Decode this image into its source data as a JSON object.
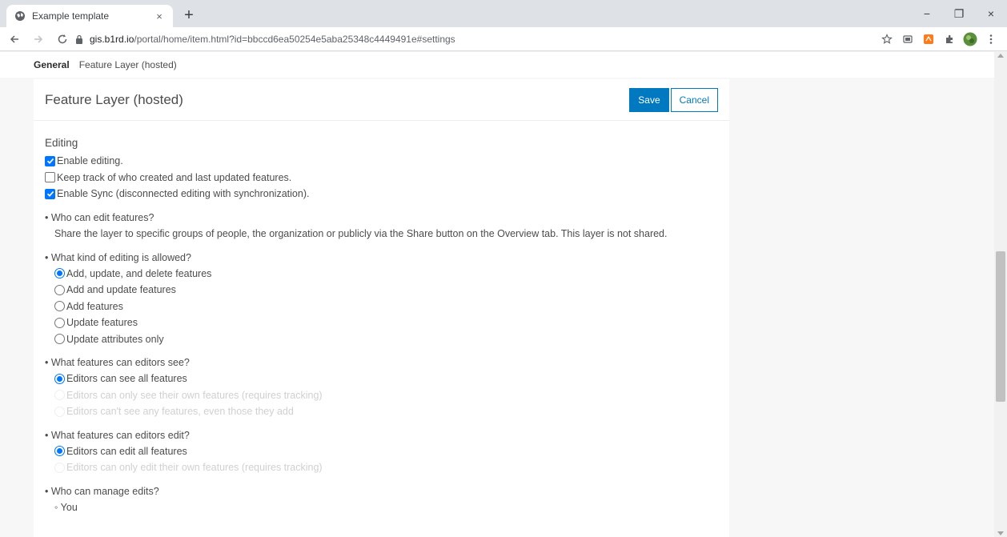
{
  "browser": {
    "tab_title": "Example template",
    "tab_close": "×",
    "new_tab": "+",
    "url_host": "gis.b1rd.io",
    "url_rest": "/portal/home/item.html?id=bbccd6ea50254e5aba25348c4449491e#settings",
    "win_minimize": "−",
    "win_maximize": "❐",
    "win_close": "×"
  },
  "subnav": {
    "active": "General",
    "link": "Feature Layer (hosted)"
  },
  "card": {
    "title": "Feature Layer (hosted)",
    "save_label": "Save",
    "cancel_label": "Cancel"
  },
  "editing": {
    "section_title": "Editing",
    "checks": [
      {
        "label": "Enable editing.",
        "checked": true
      },
      {
        "label": "Keep track of who created and last updated features.",
        "checked": false
      },
      {
        "label": "Enable Sync (disconnected editing with synchronization).",
        "checked": true
      }
    ]
  },
  "questions": {
    "who_edit": {
      "title": "• Who can edit features?",
      "desc": "Share the layer to specific groups of people, the organization or publicly via the Share button on the Overview tab. This layer is not shared."
    },
    "kind": {
      "title": "• What kind of editing is allowed?",
      "options": [
        {
          "label": "Add, update, and delete features",
          "selected": true
        },
        {
          "label": "Add and update features",
          "selected": false
        },
        {
          "label": "Add features",
          "selected": false
        },
        {
          "label": "Update features",
          "selected": false
        },
        {
          "label": "Update attributes only",
          "selected": false
        }
      ]
    },
    "see": {
      "title": "• What features can editors see?",
      "options": [
        {
          "label": "Editors can see all features",
          "selected": true,
          "disabled": false
        },
        {
          "label": "Editors can only see their own features (requires tracking)",
          "selected": false,
          "disabled": true
        },
        {
          "label": "Editors can't see any features, even those they add",
          "selected": false,
          "disabled": true
        }
      ]
    },
    "edit": {
      "title": "• What features can editors edit?",
      "options": [
        {
          "label": "Editors can edit all features",
          "selected": true,
          "disabled": false
        },
        {
          "label": "Editors can only edit their own features (requires tracking)",
          "selected": false,
          "disabled": true
        }
      ]
    },
    "manage": {
      "title": "• Who can manage edits?",
      "bullet": "◦ You"
    }
  },
  "colors": {
    "accent": "#0079c1",
    "checkbox": "#0075ff"
  }
}
